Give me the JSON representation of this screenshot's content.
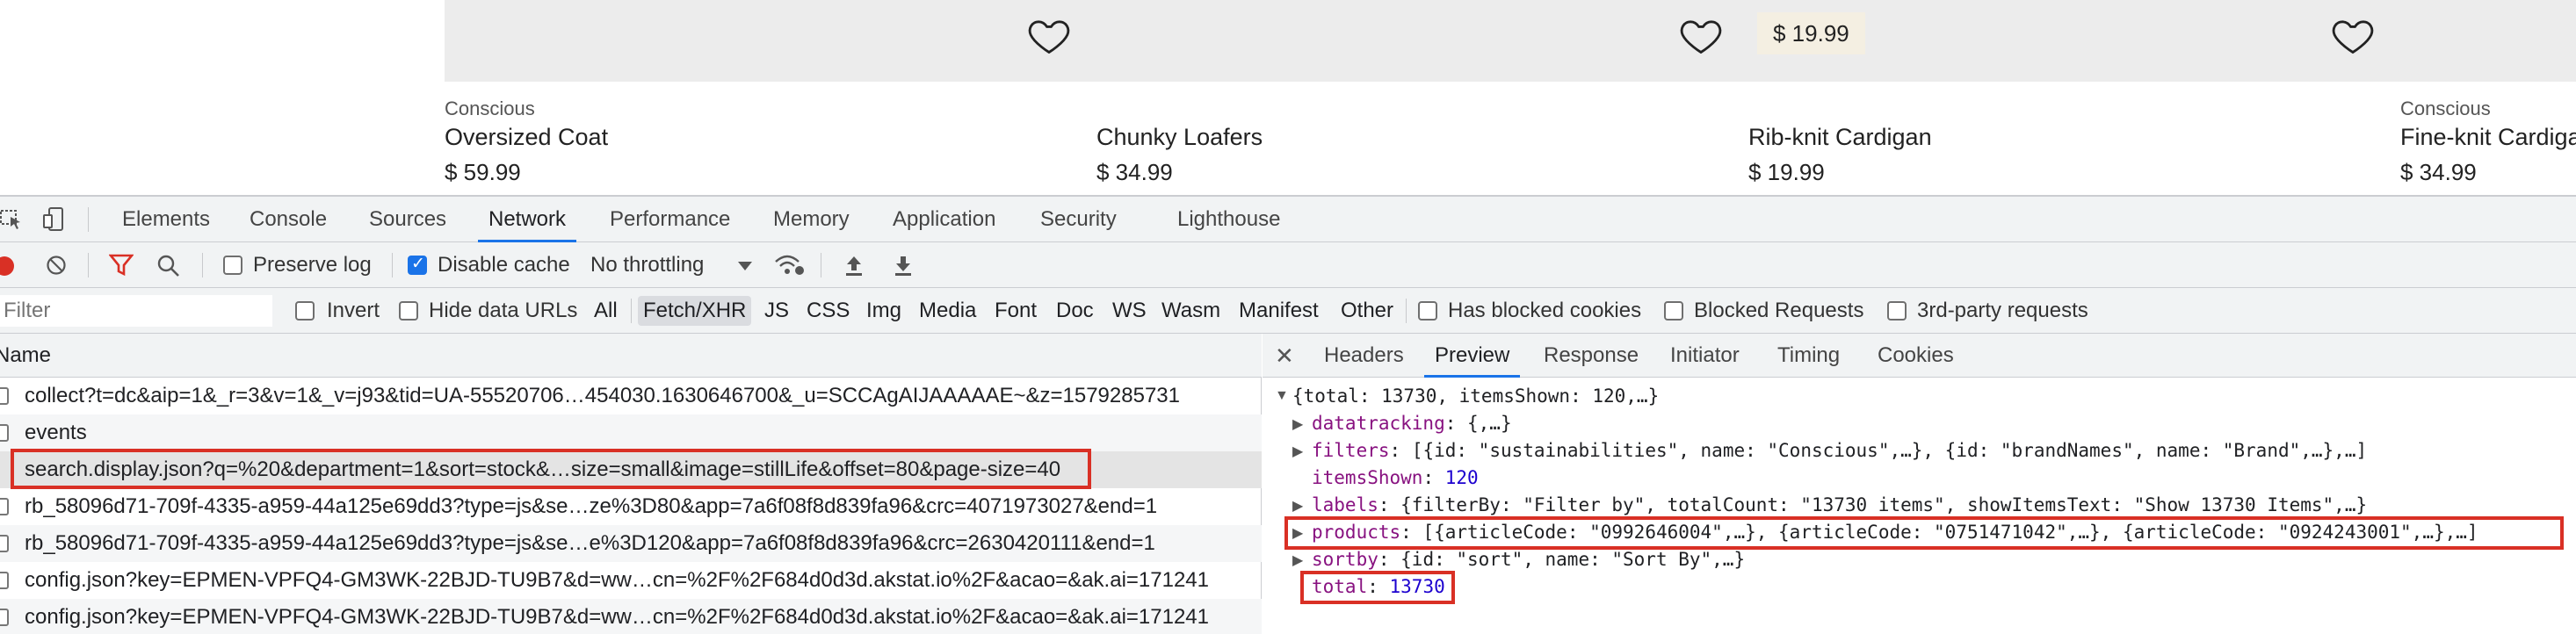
{
  "products": [
    {
      "category": "Conscious",
      "name": "Oversized Coat",
      "price": "$ 59.99",
      "badge": ""
    },
    {
      "category": "",
      "name": "Chunky Loafers",
      "price": "$ 34.99",
      "badge": ""
    },
    {
      "category": "",
      "name": "Rib-knit Cardigan",
      "price": "$ 19.99",
      "badge": "$ 19.99"
    },
    {
      "category": "Conscious",
      "name": "Fine-knit Cardigan",
      "price": "$ 34.99",
      "badge": ""
    }
  ],
  "devtools": {
    "tabs": [
      "Elements",
      "Console",
      "Sources",
      "Network",
      "Performance",
      "Memory",
      "Application",
      "Security",
      "Lighthouse"
    ],
    "active_tab": "Network",
    "toolbar": {
      "preserve_log": "Preserve log",
      "disable_cache": "Disable cache",
      "throttling": "No throttling"
    },
    "filterbar": {
      "placeholder": "Filter",
      "invert": "Invert",
      "hide_data_urls": "Hide data URLs",
      "types": [
        "All",
        "Fetch/XHR",
        "JS",
        "CSS",
        "Img",
        "Media",
        "Font",
        "Doc",
        "WS",
        "Wasm",
        "Manifest",
        "Other"
      ],
      "active_type": "Fetch/XHR",
      "has_blocked_cookies": "Has blocked cookies",
      "blocked_requests": "Blocked Requests",
      "third_party": "3rd-party requests"
    },
    "request_list": {
      "header": "Name",
      "rows": [
        "collect?t=dc&aip=1&_r=3&v=1&_v=j93&tid=UA-55520706…454030.1630646700&_u=SCCAgAIJAAAAAE~&z=1579285731",
        "events",
        "search.display.json?q=%20&department=1&sort=stock&…size=small&image=stillLife&offset=80&page-size=40",
        "rb_58096d71-709f-4335-a959-44a125e69dd3?type=js&se…ze%3D80&app=7a6f08f8d839fa96&crc=4071973027&end=1",
        "rb_58096d71-709f-4335-a959-44a125e69dd3?type=js&se…e%3D120&app=7a6f08f8d839fa96&crc=2630420111&end=1",
        "config.json?key=EPMEN-VPFQ4-GM3WK-22BJD-TU9B7&d=ww…cn=%2F%2F684d0d3d.akstat.io%2F&acao=&ak.ai=171241",
        "config.json?key=EPMEN-VPFQ4-GM3WK-22BJD-TU9B7&d=ww…cn=%2F%2F684d0d3d.akstat.io%2F&acao=&ak.ai=171241"
      ],
      "selected_index": 2
    },
    "detail_tabs": [
      "Headers",
      "Preview",
      "Response",
      "Initiator",
      "Timing",
      "Cookies"
    ],
    "active_detail_tab": "Preview",
    "preview": {
      "root": "{total: 13730, itemsShown: 120,…}",
      "lines": [
        {
          "key": "datatracking",
          "value": "{,…}",
          "expandable": true
        },
        {
          "key": "filters",
          "value": "[{id: \"sustainabilities\", name: \"Conscious\",…}, {id: \"brandNames\", name: \"Brand\",…},…]",
          "expandable": true
        },
        {
          "key": "itemsShown",
          "value": "120",
          "expandable": false
        },
        {
          "key": "labels",
          "value": "{filterBy: \"Filter by\", totalCount: \"13730 items\", showItemsText: \"Show 13730 Items\",…}",
          "expandable": true
        },
        {
          "key": "products",
          "value": "[{articleCode: \"0992646004\",…}, {articleCode: \"0751471042\",…}, {articleCode: \"0924243001\",…},…]",
          "expandable": true
        },
        {
          "key": "sortby",
          "value": "{id: \"sort\", name: \"Sort By\",…}",
          "expandable": true
        },
        {
          "key": "total",
          "value": "13730",
          "expandable": false
        }
      ]
    }
  },
  "colors": {
    "accent": "#1a73e8",
    "highlight_box": "#d93025",
    "json_key": "#881280",
    "json_number": "#1c00cf"
  }
}
